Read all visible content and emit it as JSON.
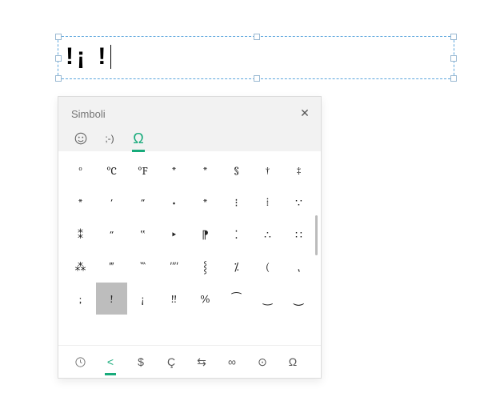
{
  "textbox": {
    "content": "!¡ !"
  },
  "panel": {
    "title": "Simboli",
    "tabs": {
      "emoji": "emoji",
      "kaomoji": ";-)",
      "symbols": "Ω"
    },
    "grid": [
      "ᵒ",
      "°C",
      "°F",
      "*",
      "*",
      "§",
      "†",
      "‡",
      "*",
      "′",
      "″",
      "•",
      "*",
      "⁝",
      "⁞",
      "∵",
      "⁑",
      "″",
      "‟",
      "‣",
      "⁋",
      "⁚",
      "∴",
      "∷",
      "⁂",
      "‴",
      "‷",
      "ʺʺ",
      "⸾",
      "⁒",
      "(",
      "⹁",
      ";",
      "!",
      "¡",
      "‼",
      "%",
      "⁀",
      "‿",
      "⏝",
      "",
      "",
      "",
      "",
      "",
      "",
      "",
      ""
    ],
    "selected_index": 33
  },
  "footer": {
    "categories": [
      "clock",
      "<",
      "$",
      "Ç",
      "⇆",
      "∞",
      "⊙",
      "Ω"
    ],
    "active_index": 1
  }
}
